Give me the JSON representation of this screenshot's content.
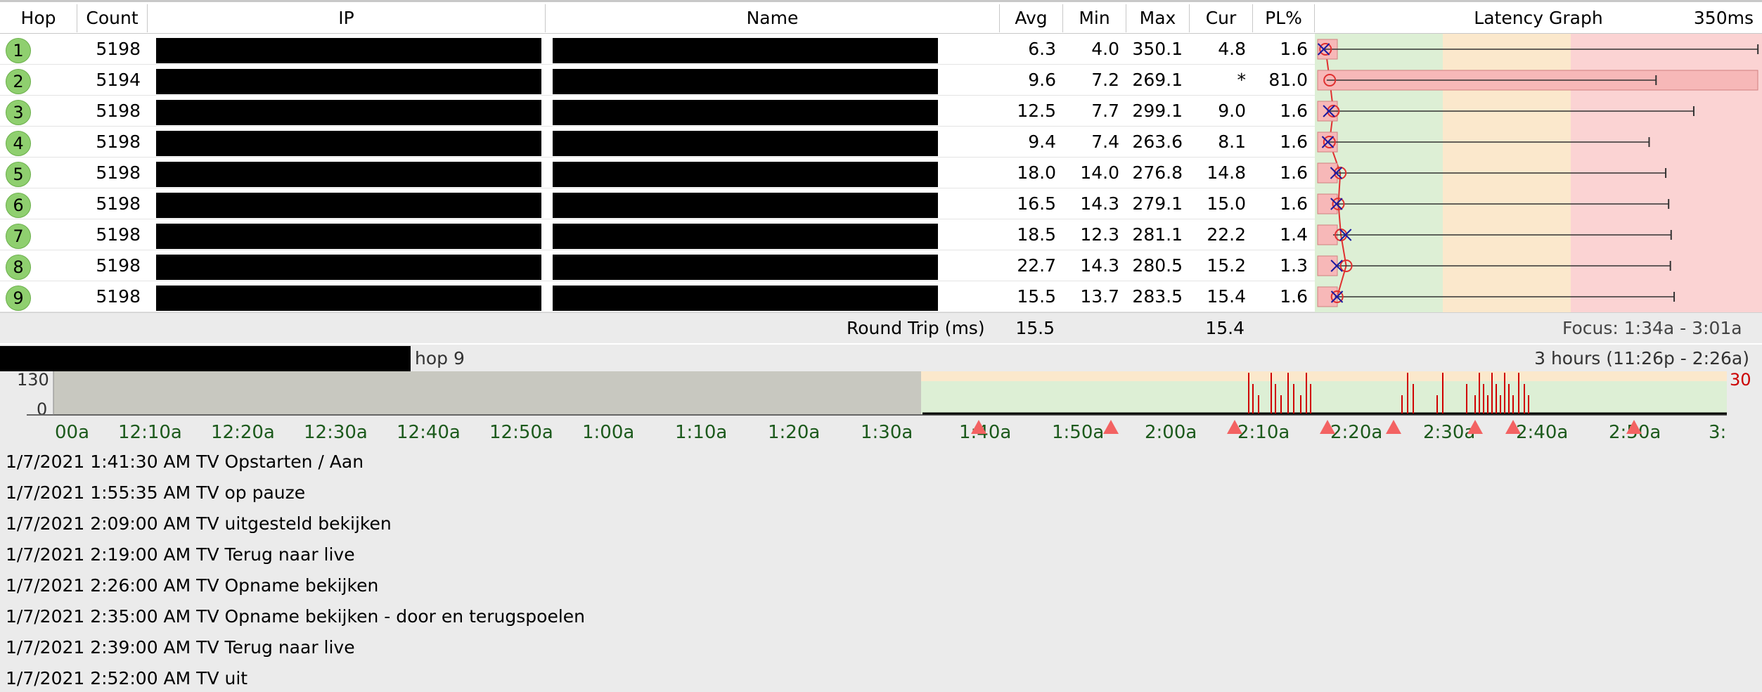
{
  "columns": {
    "hop": "Hop",
    "count": "Count",
    "ip": "IP",
    "name": "Name",
    "avg": "Avg",
    "min": "Min",
    "max": "Max",
    "cur": "Cur",
    "pl": "PL%",
    "graph": "Latency Graph",
    "graph_max": "350ms"
  },
  "hops": [
    {
      "hop": "1",
      "count": "5198",
      "avg": "6.3",
      "min": "4.0",
      "max": "350.1",
      "cur": "4.8",
      "pl": "1.6"
    },
    {
      "hop": "2",
      "count": "5194",
      "avg": "9.6",
      "min": "7.2",
      "max": "269.1",
      "cur": "*",
      "pl": "81.0"
    },
    {
      "hop": "3",
      "count": "5198",
      "avg": "12.5",
      "min": "7.7",
      "max": "299.1",
      "cur": "9.0",
      "pl": "1.6"
    },
    {
      "hop": "4",
      "count": "5198",
      "avg": "9.4",
      "min": "7.4",
      "max": "263.6",
      "cur": "8.1",
      "pl": "1.6"
    },
    {
      "hop": "5",
      "count": "5198",
      "avg": "18.0",
      "min": "14.0",
      "max": "276.8",
      "cur": "14.8",
      "pl": "1.6"
    },
    {
      "hop": "6",
      "count": "5198",
      "avg": "16.5",
      "min": "14.3",
      "max": "279.1",
      "cur": "15.0",
      "pl": "1.6"
    },
    {
      "hop": "7",
      "count": "5198",
      "avg": "18.5",
      "min": "12.3",
      "max": "281.1",
      "cur": "22.2",
      "pl": "1.4"
    },
    {
      "hop": "8",
      "count": "5198",
      "avg": "22.7",
      "min": "14.3",
      "max": "280.5",
      "cur": "15.2",
      "pl": "1.3"
    },
    {
      "hop": "9",
      "count": "5198",
      "avg": "15.5",
      "min": "13.7",
      "max": "283.5",
      "cur": "15.4",
      "pl": "1.6"
    }
  ],
  "round_trip": {
    "label": "Round Trip (ms)",
    "avg": "15.5",
    "cur": "15.4",
    "focus": "Focus: 1:34a - 3:01a"
  },
  "timeline": {
    "hop_label": "hop 9",
    "range_label": "3 hours (11:26p - 2:26a)",
    "y_max": "130",
    "y_min": "0",
    "pl_scale": "30",
    "ticks": [
      "00a",
      "12:10a",
      "12:20a",
      "12:30a",
      "12:40a",
      "12:50a",
      "1:00a",
      "1:10a",
      "1:20a",
      "1:30a",
      "1:40a",
      "1:50a",
      "2:00a",
      "2:10a",
      "2:20a",
      "2:30a",
      "2:40a",
      "2:50a",
      "3:"
    ]
  },
  "events": [
    "1/7/2021 1:41:30 AM TV Opstarten / Aan",
    "1/7/2021 1:55:35 AM TV op pauze",
    "1/7/2021 2:09:00 AM TV uitgesteld bekijken",
    "1/7/2021 2:19:00 AM TV Terug naar live",
    "1/7/2021 2:26:00 AM TV Opname bekijken",
    "1/7/2021 2:35:00 AM TV Opname bekijken - door en terugspoelen",
    "1/7/2021 2:39:00 AM TV Terug naar live",
    "1/7/2021 2:52:00 AM TV uit"
  ],
  "colors": {
    "good": "#ddefd5",
    "warn": "#fbe8cc",
    "bad": "#fbd3d3",
    "hop_circle": "#8fcf6f",
    "avg_line": "#e03030",
    "min_marker": "#1a1aa0",
    "tick_text": "#1c5a1c"
  }
}
